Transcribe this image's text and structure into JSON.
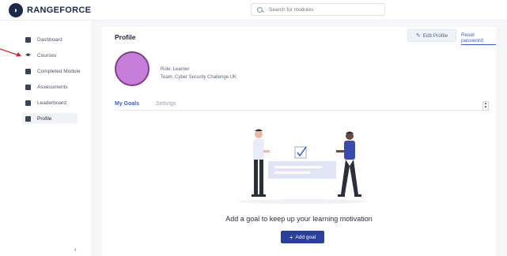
{
  "header": {
    "brand": "RANGEFORCE",
    "search_placeholder": "Search for modules"
  },
  "sidebar": {
    "items": [
      {
        "label": "Dashboard",
        "icon": "dashboard-icon"
      },
      {
        "label": "Courses",
        "icon": "graduation-cap-icon"
      },
      {
        "label": "Completed Module",
        "icon": "list-icon"
      },
      {
        "label": "Assessments",
        "icon": "assessment-icon"
      },
      {
        "label": "Leaderboard",
        "icon": "leaderboard-icon"
      },
      {
        "label": "Profile",
        "icon": "profile-icon",
        "active": true
      }
    ],
    "collapse_label": "‹"
  },
  "profile": {
    "title": "Profile",
    "edit_label": "Edit Profile",
    "reset_label": "Reset password",
    "role": "Role: Learner",
    "team": "Team: Cyber Security Challenge UK",
    "avatar_color": "#c67ed9"
  },
  "tabs": [
    {
      "label": "My Goals",
      "active": true
    },
    {
      "label": "Settings",
      "active": false
    }
  ],
  "goals": {
    "empty_message": "Add a goal to keep up your learning motivation",
    "add_label": "Add goal"
  },
  "colors": {
    "accent": "#3a5bd6",
    "primary_button": "#2b3f9e",
    "annotation_arrow": "#e02020"
  }
}
